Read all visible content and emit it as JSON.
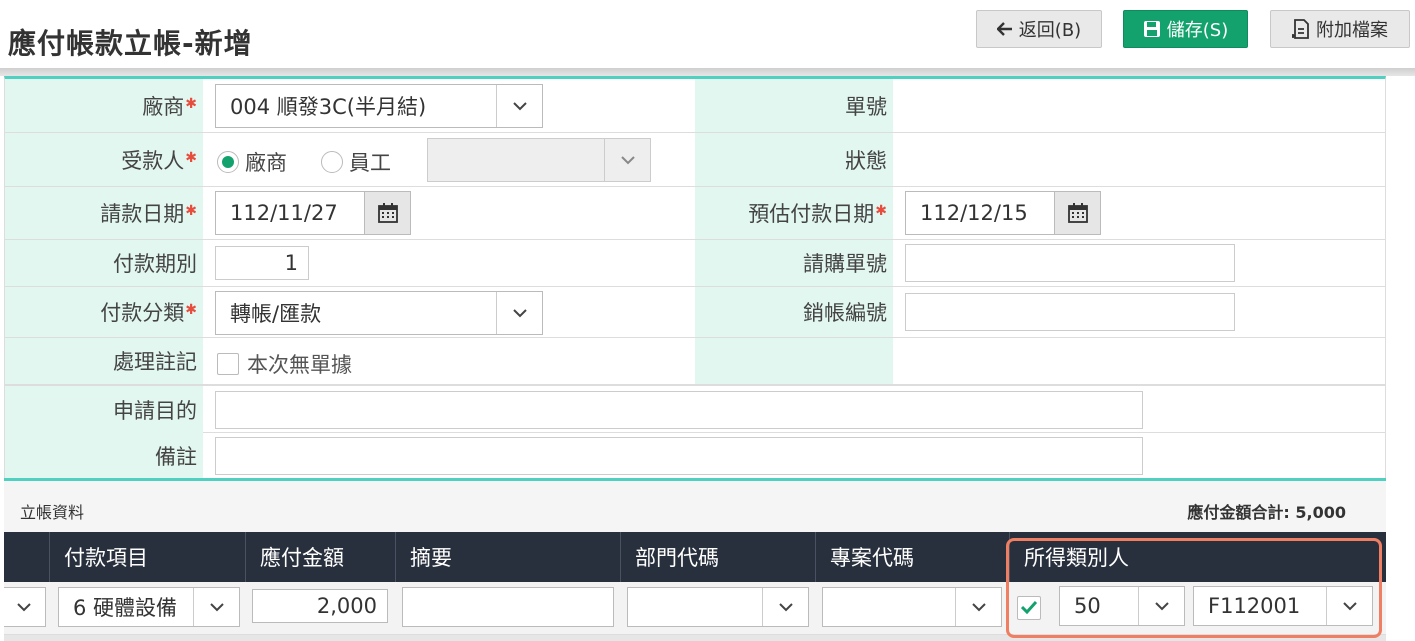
{
  "header": {
    "title": "應付帳款立帳-新增",
    "back_label": "返回(B)",
    "save_label": "儲存(S)",
    "attach_label": "附加檔案"
  },
  "form": {
    "vendor_label": "廠商",
    "vendor_value": "004 順發3C(半月結)",
    "order_no_label": "單號",
    "payee_label": "受款人",
    "payee_option_vendor": "廠商",
    "payee_option_employee": "員工",
    "status_label": "狀態",
    "request_date_label": "請款日期",
    "request_date_value": "112/11/27",
    "est_pay_date_label": "預估付款日期",
    "est_pay_date_value": "112/12/15",
    "pay_period_label": "付款期別",
    "pay_period_value": "1",
    "purchase_no_label": "請購單號",
    "pay_category_label": "付款分類",
    "pay_category_value": "轉帳/匯款",
    "writeoff_no_label": "銷帳編號",
    "process_note_label": "處理註記",
    "no_receipt_label": "本次無單據",
    "purpose_label": "申請目的",
    "remark_label": "備註"
  },
  "section": {
    "title": "立帳資料",
    "total_label": "應付金額合計: 5,000"
  },
  "grid": {
    "columns": [
      "付款項目",
      "應付金額",
      "摘要",
      "部門代碼",
      "專案代碼",
      "所得類別人"
    ],
    "row": {
      "pay_item": "6 硬體設備",
      "amount": "2,000",
      "income_type": "50",
      "income_person": "F112001"
    }
  },
  "colors": {
    "accent": "#13a26d",
    "label_bg": "#e3f7f1",
    "teal_border": "#4fd0c0",
    "grid_header": "#29303d",
    "highlight": "#ef7e63"
  }
}
